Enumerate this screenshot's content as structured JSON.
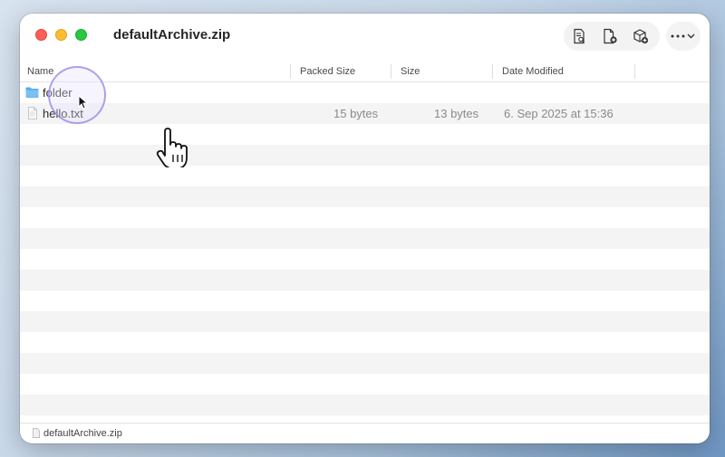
{
  "window": {
    "title": "defaultArchive.zip"
  },
  "toolbar": {
    "actions": [
      {
        "name": "preview-document-icon"
      },
      {
        "name": "add-file-icon"
      },
      {
        "name": "add-archive-icon"
      }
    ],
    "more_menu": {
      "icon": "ellipsis-icon",
      "chevron": "chevron-down-icon"
    }
  },
  "columns": {
    "name": "Name",
    "packed_size": "Packed Size",
    "size": "Size",
    "date_modified": "Date Modified"
  },
  "rows": [
    {
      "name": "folder",
      "type": "folder",
      "packed_size": "",
      "size": "",
      "date_modified": ""
    },
    {
      "name": "hello.txt",
      "type": "file",
      "packed_size": "15 bytes",
      "size": "13 bytes",
      "date_modified": "6. Sep 2025 at 15:36"
    }
  ],
  "statusbar": {
    "text": "defaultArchive.zip"
  },
  "colors": {
    "close": "#ff5f57",
    "minimize": "#febc2e",
    "maximize": "#28c840",
    "folder": "#5aa9e6",
    "stripe": "#f4f4f4"
  }
}
